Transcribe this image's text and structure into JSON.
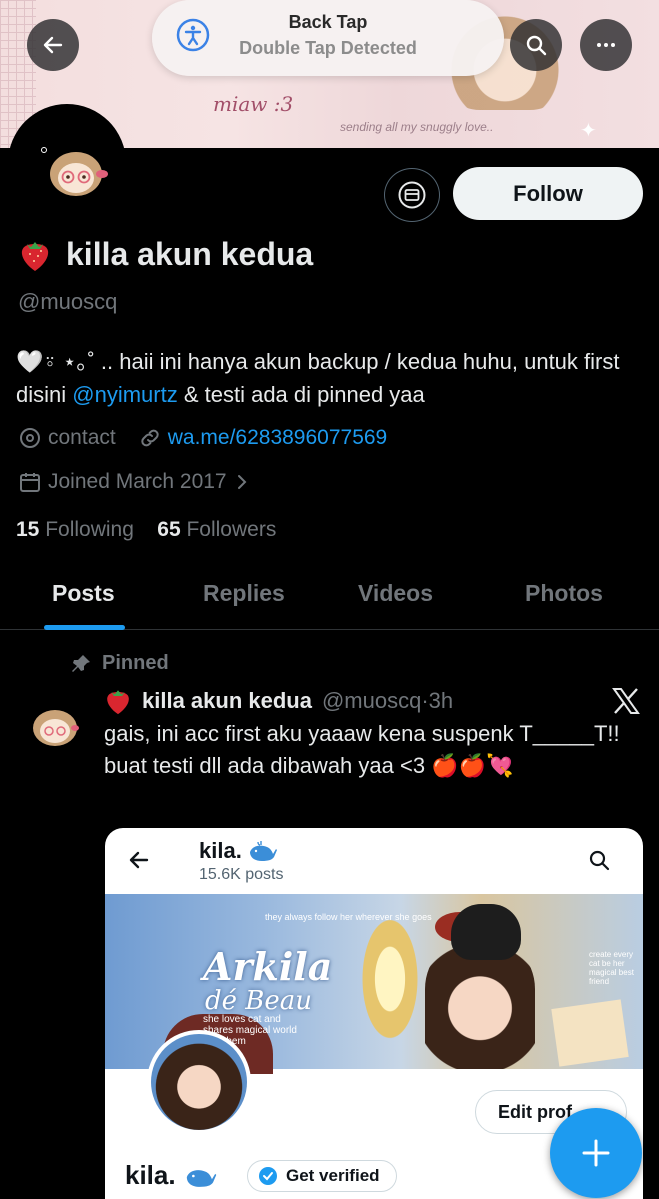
{
  "banner": {
    "miaw_text": "miaw",
    "miaw_suffix": ":3",
    "sending_text": "sending all my snuggly love.."
  },
  "toast": {
    "title": "Back Tap",
    "subtitle": "Double Tap Detected"
  },
  "profile": {
    "name": "killa akun kedua",
    "handle": "@muoscq",
    "follow_label": "Follow",
    "bio_prefix": "🤍⍤ ⋆｡˚ .. haii ini hanya akun backup / kedua huhu, untuk first disini ",
    "bio_mention": "@nyimurtz",
    "bio_suffix": " & testi ada di pinned yaa",
    "location": "contact",
    "website": "wa.me/6283896077569",
    "joined": "Joined March 2017",
    "following_count": "15",
    "following_label": "Following",
    "followers_count": "65",
    "followers_label": "Followers"
  },
  "tabs": [
    {
      "label": "Posts",
      "active": true
    },
    {
      "label": "Replies",
      "active": false
    },
    {
      "label": "Videos",
      "active": false
    },
    {
      "label": "Photos",
      "active": false
    }
  ],
  "post": {
    "pinned_label": "Pinned",
    "author_name": "killa akun kedua",
    "author_handle": "@muoscq",
    "time": "·3h",
    "text": "gais, ini acc first aku yaaaw kena suspenk T_____T!! buat testi dll ada dibawah yaa <3 🍎🍎💘"
  },
  "embedded": {
    "name": "kila.",
    "posts": "15.6K posts",
    "banner_title": "Arkila",
    "banner_subtitle": "dé Beau",
    "banner_small_top": "they always follow her wherever she goes",
    "banner_small_left": "she loves cat and shares magical world with them",
    "banner_small_right": "create every cat be her magical best friend",
    "edit_label": "Edit prof",
    "profile_name": "kila.",
    "get_verified": "Get verified"
  },
  "colors": {
    "accent": "#1d9bf0",
    "background": "#000000",
    "muted": "#71767b"
  }
}
